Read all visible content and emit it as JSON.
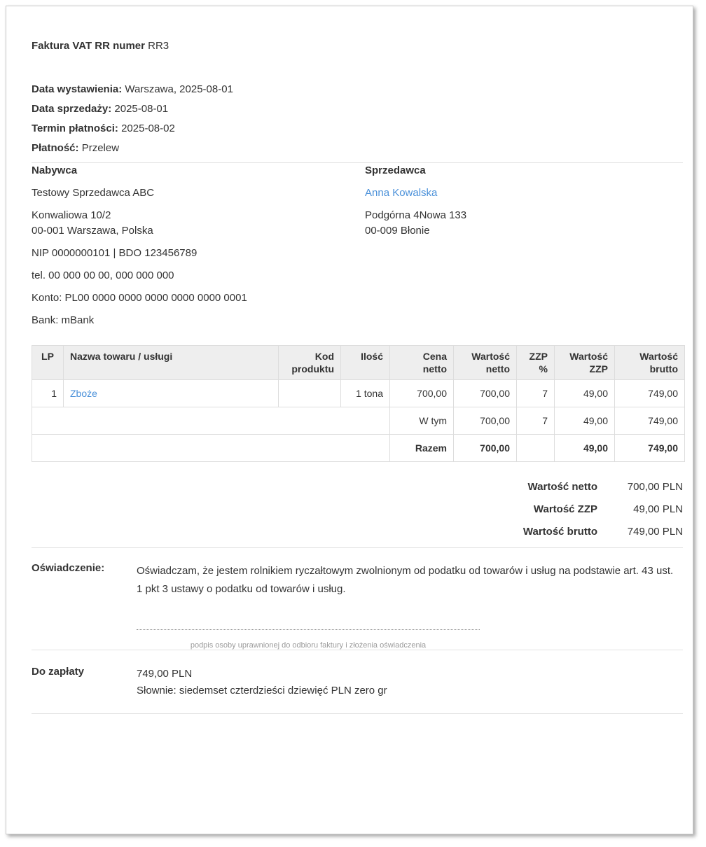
{
  "header": {
    "title_label": "Faktura VAT RR numer",
    "title_number": "RR3"
  },
  "meta": {
    "issue_label": "Data wystawienia:",
    "issue_value": "Warszawa, 2025-08-01",
    "sale_label": "Data sprzedaży:",
    "sale_value": "2025-08-01",
    "due_label": "Termin płatności:",
    "due_value": "2025-08-02",
    "payment_label": "Płatność:",
    "payment_value": "Przelew"
  },
  "buyer": {
    "heading": "Nabywca",
    "name": "Testowy Sprzedawca ABC",
    "address_line1": "Konwaliowa 10/2",
    "address_line2": "00-001 Warszawa, Polska",
    "tax_ids": "NIP 0000000101 | BDO 123456789",
    "phone": "tel. 00 000 00 00, 000 000 000",
    "account": "Konto: PL00 0000 0000 0000 0000 0000 0001",
    "bank": "Bank: mBank"
  },
  "seller": {
    "heading": "Sprzedawca",
    "name": "Anna Kowalska",
    "address_line1": "Podgórna 4Nowa 133",
    "address_line2": "00-009 Błonie"
  },
  "items_table": {
    "headers": [
      "LP",
      "Nazwa towaru / usługi",
      "Kod produktu",
      "Ilość",
      "Cena netto",
      "Wartość netto",
      "ZZP %",
      "Wartość ZZP",
      "Wartość brutto"
    ],
    "rows": [
      {
        "lp": "1",
        "name": "Zboże",
        "code": "",
        "qty": "1 tona",
        "unit_net": "700,00",
        "net": "700,00",
        "zzp_rate": "7",
        "zzp": "49,00",
        "gross": "749,00"
      }
    ],
    "subtotal_row": {
      "label": "W tym",
      "net": "700,00",
      "zzp_rate": "7",
      "zzp": "49,00",
      "gross": "749,00"
    },
    "total_row": {
      "label": "Razem",
      "net": "700,00",
      "zzp_rate": "",
      "zzp": "49,00",
      "gross": "749,00"
    }
  },
  "totals": [
    {
      "label": "Wartość netto",
      "value": "700,00 PLN"
    },
    {
      "label": "Wartość ZZP",
      "value": "49,00 PLN"
    },
    {
      "label": "Wartość brutto",
      "value": "749,00 PLN"
    }
  ],
  "declaration": {
    "label": "Oświadczenie:",
    "text": "Oświadczam, że jestem rolnikiem ryczałtowym zwolnionym od podatku od towarów i usług na podstawie art. 43 ust. 1 pkt 3 ustawy o podatku od towarów i usług.",
    "signature_caption": "podpis osoby uprawnionej do odbioru faktury i złożenia oświadczenia"
  },
  "payment_due": {
    "label": "Do zapłaty",
    "amount": "749,00 PLN",
    "in_words": "Słownie: siedemset czterdzieści dziewięć PLN zero gr"
  },
  "colors": {
    "link": "#4a90d9",
    "text": "#333333",
    "table_header_bg": "#eeeeee",
    "table_border": "#dddddd",
    "divider": "#e2e2e2",
    "muted_caption": "#9b9b9b"
  }
}
